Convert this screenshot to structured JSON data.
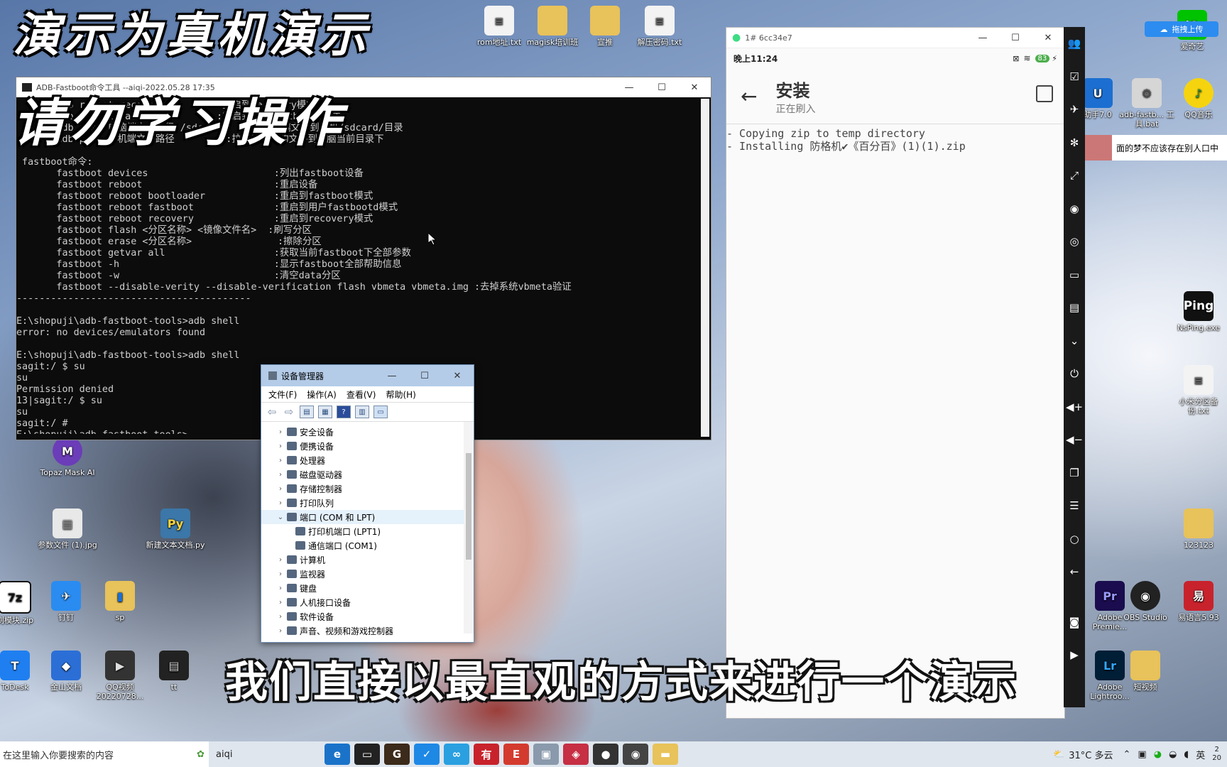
{
  "overlay": {
    "title_line1": "演示为真机演示",
    "title_line2": "请勿学习操作",
    "subtitle": "我们直接以最直观的方式来进行一个演示"
  },
  "desktop_icons": [
    {
      "label": "Topaz Mask AI",
      "icon": "topaz-icon",
      "color": "#6b3db8"
    },
    {
      "label": "参数文件 (1).jpg",
      "icon": "image-file-icon",
      "color": "#dcdcdc"
    },
    {
      "label": "新建文本文档.py",
      "icon": "python-icon",
      "color": "#3b77a8"
    },
    {
      "label": "刷模块.zip",
      "icon": "7z-icon",
      "color": "#111111"
    },
    {
      "label": "钉钉",
      "icon": "dingtalk-icon",
      "color": "#2a8cf0"
    },
    {
      "label": "sp",
      "icon": "folder-icon",
      "color": "#e8c25a"
    },
    {
      "label": "ToDesk",
      "icon": "todesk-icon",
      "color": "#1f7ff0"
    },
    {
      "label": "金山文档",
      "icon": "kdocs-icon",
      "color": "#2b6fd6"
    },
    {
      "label": "QQ视频 20220728...",
      "icon": "video-icon",
      "color": "#333333"
    },
    {
      "label": "tt",
      "icon": "file-icon",
      "color": "#222222"
    },
    {
      "label": "rom地址.txt",
      "icon": "txt-icon",
      "color": "#f0f0f0"
    },
    {
      "label": "magisk培训班",
      "icon": "folder-icon",
      "color": "#e8c25a"
    },
    {
      "label": "宣推",
      "icon": "folder-icon",
      "color": "#e8c25a"
    },
    {
      "label": "解压密码.txt",
      "icon": "txt-icon",
      "color": "#f0f0f0"
    },
    {
      "label": "爱奇艺",
      "icon": "iqiyi-icon",
      "color": "#00c300"
    },
    {
      "label": "助手7.0",
      "icon": "app-icon",
      "color": "#1c6fd1"
    },
    {
      "label": "adb-fastb... 工具.bat",
      "icon": "bat-icon",
      "color": "#d6d6d6"
    },
    {
      "label": "QQ音乐",
      "icon": "qqmusic-icon",
      "color": "#f5d40f"
    },
    {
      "label": "NsPing.exe",
      "icon": "ping-icon",
      "color": "#111111"
    },
    {
      "label": "小米分区备份.txt",
      "icon": "txt-icon",
      "color": "#f0f0f0"
    },
    {
      "label": "123123",
      "icon": "folder-icon",
      "color": "#e8c25a"
    },
    {
      "label": "Adobe Premie...",
      "icon": "premiere-icon",
      "color": "#1a0c4e"
    },
    {
      "label": "OBS Studio",
      "icon": "obs-icon",
      "color": "#222222"
    },
    {
      "label": "易语言5.93",
      "icon": "eyuyan-icon",
      "color": "#c8232c"
    },
    {
      "label": "Adobe Lightroo...",
      "icon": "lightroom-icon",
      "color": "#001e36"
    },
    {
      "label": "短视频",
      "icon": "folder-icon",
      "color": "#e8c25a"
    }
  ],
  "cmd": {
    "title": "ADB-Fastboot命令工具   --aiqi-2022.05.28 17:35",
    "lines": [
      "       adb reboot recovery         :重启到recovery模式",
      "       adb reboot fastboot         :重启到用户fastbootd模式",
      "       adb push 电脑端文件路径 /sdcard/  :推送电脑端文件到手机/sdcard/目录",
      "       adb pull 手机端文件路径         :拉取手机端的文件到电脑当前目录下",
      "",
      " fastboot命令:",
      "       fastboot devices                      :列出fastboot设备",
      "       fastboot reboot                       :重启设备",
      "       fastboot reboot bootloader            :重启到fastboot模式",
      "       fastboot reboot fastboot              :重启到用户fastbootd模式",
      "       fastboot reboot recovery              :重启到recovery模式",
      "       fastboot flash <分区名称> <镜像文件名>  :刷写分区",
      "       fastboot erase <分区名称>               :擦除分区",
      "       fastboot getvar all                   :获取当前fastboot下全部参数",
      "       fastboot -h                           :显示fastboot全部帮助信息",
      "       fastboot -w                           :清空data分区",
      "       fastboot --disable-verity --disable-verification flash vbmeta vbmeta.img :去掉系统vbmeta验证",
      "-----------------------------------------",
      "",
      "E:\\shopuji\\adb-fastboot-tools>adb shell",
      "error: no devices/emulators found",
      "",
      "E:\\shopuji\\adb-fastboot-tools>adb shell",
      "sagit:/ $ su",
      "su",
      "Permission denied",
      "13|sagit:/ $ su",
      "su",
      "sagit:/ #",
      "E:\\shopuji\\adb-fastboot-tools>"
    ]
  },
  "devmgr": {
    "title": "设备管理器",
    "menu": [
      "文件(F)",
      "操作(A)",
      "查看(V)",
      "帮助(H)"
    ],
    "tree": [
      {
        "label": "安全设备",
        "expanded": false,
        "child": false
      },
      {
        "label": "便携设备",
        "expanded": false,
        "child": false
      },
      {
        "label": "处理器",
        "expanded": false,
        "child": false
      },
      {
        "label": "磁盘驱动器",
        "expanded": false,
        "child": false
      },
      {
        "label": "存储控制器",
        "expanded": false,
        "child": false
      },
      {
        "label": "打印队列",
        "expanded": false,
        "child": false
      },
      {
        "label": "端口 (COM 和 LPT)",
        "expanded": true,
        "child": false
      },
      {
        "label": "打印机端口 (LPT1)",
        "expanded": false,
        "child": true
      },
      {
        "label": "通信端口 (COM1)",
        "expanded": false,
        "child": true
      },
      {
        "label": "计算机",
        "expanded": false,
        "child": false
      },
      {
        "label": "监视器",
        "expanded": false,
        "child": false
      },
      {
        "label": "键盘",
        "expanded": false,
        "child": false
      },
      {
        "label": "人机接口设备",
        "expanded": false,
        "child": false
      },
      {
        "label": "软件设备",
        "expanded": false,
        "child": false
      },
      {
        "label": "声音、视频和游戏控制器",
        "expanded": false,
        "child": false
      }
    ]
  },
  "phone": {
    "window_title": "1#   6cc34e7",
    "time": "晚上11:24",
    "battery": "83",
    "page_title": "安装",
    "page_subtitle": "正在刷入",
    "log": [
      "- Copying zip to temp directory",
      "- Installing 防格机✔《百分百》(1)(1).zip"
    ]
  },
  "floating": {
    "upload_label": "拖拽上传",
    "notice": "面的梦不应该存在别人口中"
  },
  "taskbar": {
    "search_placeholder": "在这里输入你要搜索的内容",
    "user": "aiqi",
    "weather": "31°C 多云",
    "ime": "英",
    "clock_top": "2",
    "clock_bottom": "20"
  }
}
